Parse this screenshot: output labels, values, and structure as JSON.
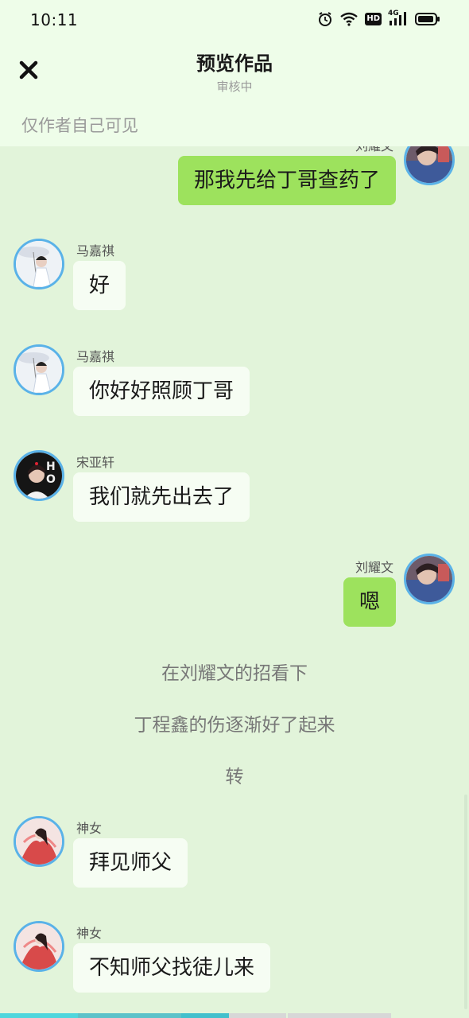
{
  "status_bar": {
    "time": "10:11",
    "icons": [
      "alarm-icon",
      "wifi-icon",
      "hd-icon",
      "4g-signal-icon",
      "battery-icon"
    ],
    "network_label": "4G",
    "hd_label": "HD"
  },
  "header": {
    "close_icon": "close-icon",
    "title": "预览作品",
    "subtitle": "审核中",
    "visibility": "仅作者自己可见"
  },
  "colors": {
    "header_bg": "#eefde9",
    "chat_bg": "#e2f4da",
    "bubble_left": "#f6fdf3",
    "bubble_right": "#9de25d",
    "avatar_ring": "#5ab2e8"
  },
  "messages": [
    {
      "sender": "刘耀文",
      "text": "那我先给丁哥查药了",
      "side": "right"
    },
    {
      "sender": "马嘉祺",
      "text": "好",
      "side": "left"
    },
    {
      "sender": "马嘉祺",
      "text": "你好好照顾丁哥",
      "side": "left"
    },
    {
      "sender": "宋亚轩",
      "text": "我们就先出去了",
      "side": "left"
    },
    {
      "sender": "刘耀文",
      "text": "嗯",
      "side": "right"
    },
    {
      "sender": "神女",
      "text": "拜见师父",
      "side": "left"
    },
    {
      "sender": "神女",
      "text": "不知师父找徒儿来",
      "side": "left"
    }
  ],
  "narrations": [
    "在刘耀文的招看下",
    "丁程鑫的伤逐渐好了起来",
    "转"
  ]
}
